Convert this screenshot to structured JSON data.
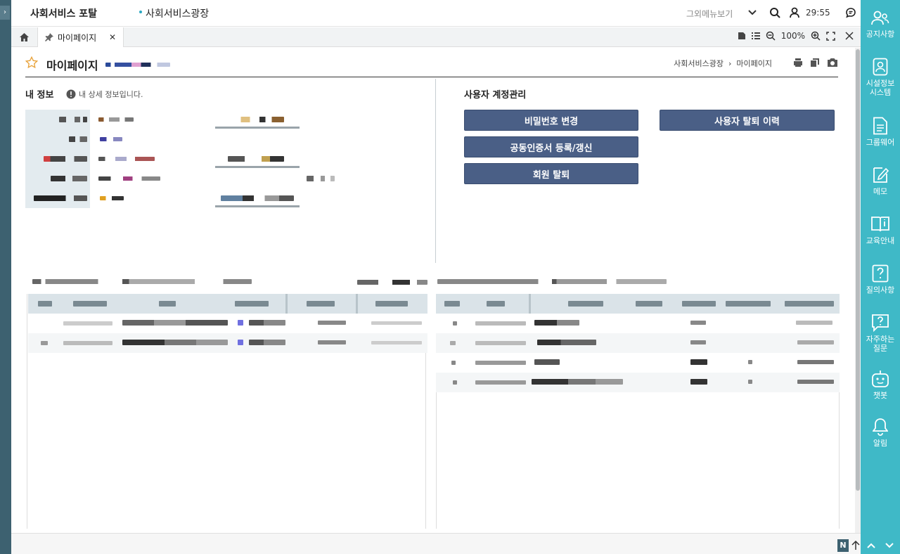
{
  "header": {
    "brand": "사회서비스 포탈",
    "subtitle": "사회서비스광장",
    "other_menu": "그외메뉴보기",
    "session_time": "29:55"
  },
  "tabs": {
    "active_label": "마이페이지",
    "zoom": "100%"
  },
  "page": {
    "title": "마이페이지",
    "breadcrumb_root": "사회서비스광장",
    "breadcrumb_sep": "›",
    "breadcrumb_current": "마이페이지"
  },
  "my_info": {
    "section_title": "내 정보",
    "note": "내 상세 정보입니다."
  },
  "account": {
    "section_title": "사용자 계정관리",
    "change_password": "비밀번호 변경",
    "withdraw_history": "사용자 탈퇴 이력",
    "cert_register": "공동인증서 등록/갱신",
    "withdraw": "회원 탈퇴"
  },
  "sidebar": {
    "items": [
      {
        "label": "공지사항",
        "icon": "people-icon"
      },
      {
        "label": "시설정보 시스템",
        "icon": "badge-icon"
      },
      {
        "label": "그룹웨어",
        "icon": "document-icon"
      },
      {
        "label": "메모",
        "icon": "memo-icon"
      },
      {
        "label": "교육안내",
        "icon": "book-icon"
      },
      {
        "label": "질의사항",
        "icon": "question-icon"
      },
      {
        "label": "자주하는 질문",
        "icon": "faq-icon"
      },
      {
        "label": "챗봇",
        "icon": "robot-icon"
      },
      {
        "label": "알림",
        "icon": "bell-icon"
      }
    ]
  },
  "footer": {
    "n_badge": "N"
  },
  "colors": {
    "accent": "#3fb9c7",
    "button": "#4a5f86",
    "left_bar": "#3d6170"
  }
}
